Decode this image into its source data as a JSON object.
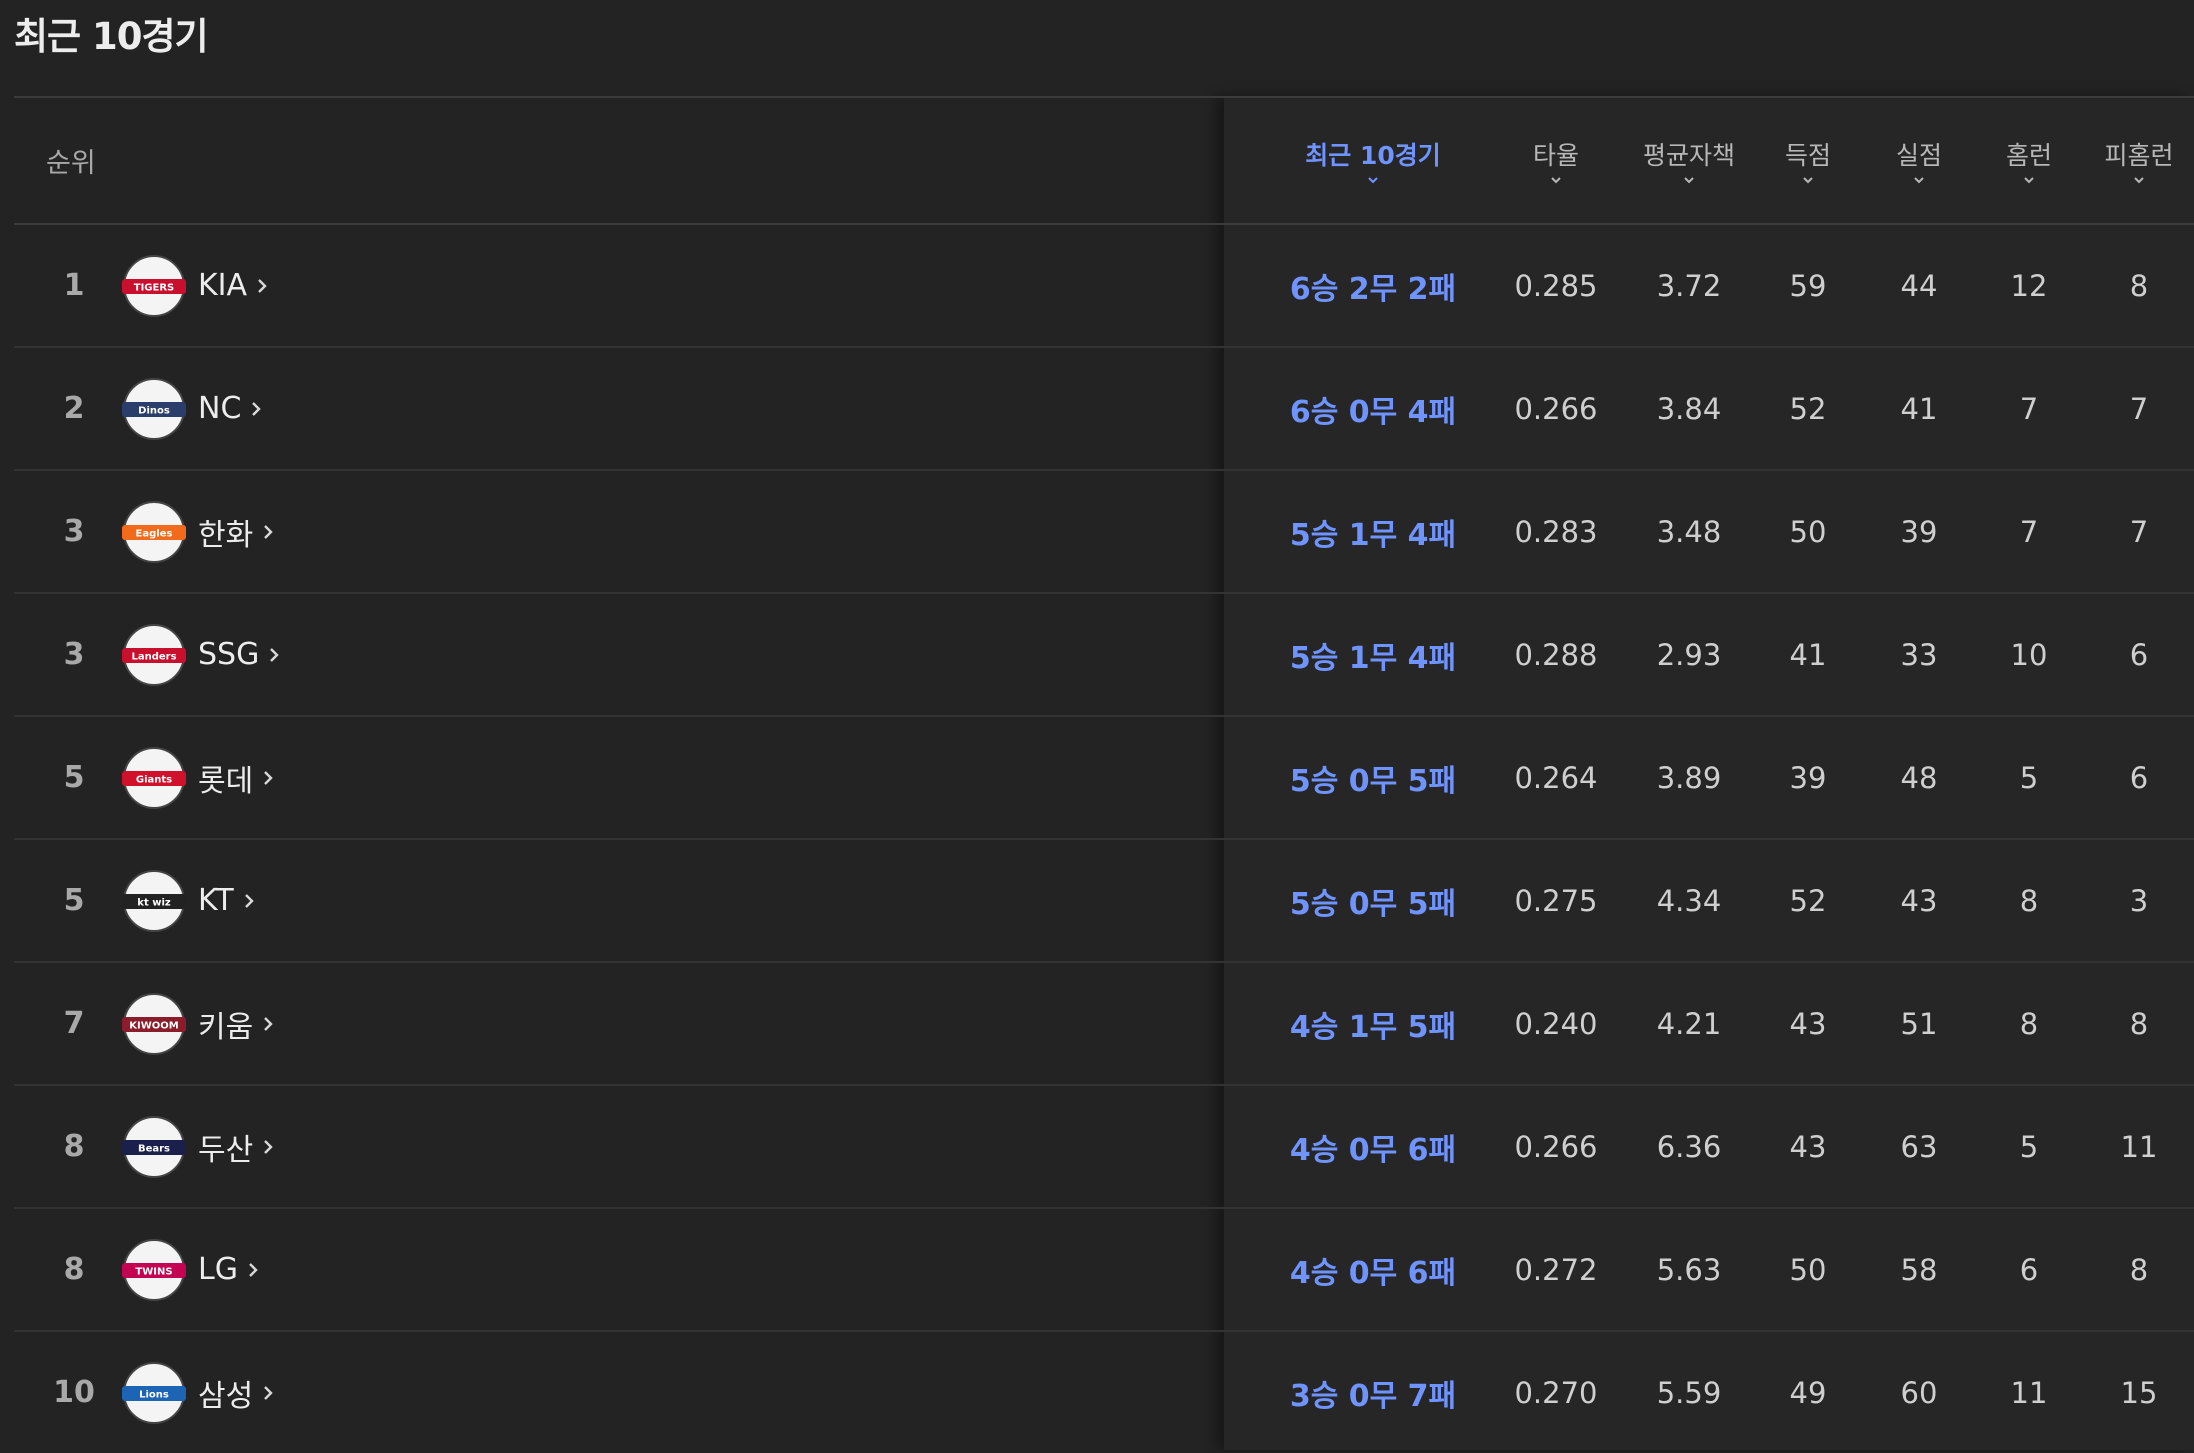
{
  "title": "최근 10경기",
  "headers": {
    "rank": "순위",
    "recent10": "최근 10경기",
    "avg": "타율",
    "era": "평균자책",
    "runs": "득점",
    "runs_allowed": "실점",
    "hr": "홈런",
    "hr_allowed": "피홈런"
  },
  "colors": {
    "accent": "#6f93ff",
    "background": "#232323"
  },
  "rows": [
    {
      "rank": "1",
      "team": "KIA",
      "logo_text": "TIGERS",
      "logo_color": "#c8102e",
      "record": "6승 2무 2패",
      "avg": "0.285",
      "era": "3.72",
      "runs": "59",
      "runs_allowed": "44",
      "hr": "12",
      "hr_allowed": "8"
    },
    {
      "rank": "2",
      "team": "NC",
      "logo_text": "Dinos",
      "logo_color": "#2b3e6b",
      "record": "6승 0무 4패",
      "avg": "0.266",
      "era": "3.84",
      "runs": "52",
      "runs_allowed": "41",
      "hr": "7",
      "hr_allowed": "7"
    },
    {
      "rank": "3",
      "team": "한화",
      "logo_text": "Eagles",
      "logo_color": "#f26b1d",
      "record": "5승 1무 4패",
      "avg": "0.283",
      "era": "3.48",
      "runs": "50",
      "runs_allowed": "39",
      "hr": "7",
      "hr_allowed": "7"
    },
    {
      "rank": "3",
      "team": "SSG",
      "logo_text": "Landers",
      "logo_color": "#c8102e",
      "record": "5승 1무 4패",
      "avg": "0.288",
      "era": "2.93",
      "runs": "41",
      "runs_allowed": "33",
      "hr": "10",
      "hr_allowed": "6"
    },
    {
      "rank": "5",
      "team": "롯데",
      "logo_text": "Giants",
      "logo_color": "#d0112b",
      "record": "5승 0무 5패",
      "avg": "0.264",
      "era": "3.89",
      "runs": "39",
      "runs_allowed": "48",
      "hr": "5",
      "hr_allowed": "6"
    },
    {
      "rank": "5",
      "team": "KT",
      "logo_text": "kt wiz",
      "logo_color": "#222222",
      "record": "5승 0무 5패",
      "avg": "0.275",
      "era": "4.34",
      "runs": "52",
      "runs_allowed": "43",
      "hr": "8",
      "hr_allowed": "3"
    },
    {
      "rank": "7",
      "team": "키움",
      "logo_text": "KIWOOM",
      "logo_color": "#8b1c2b",
      "record": "4승 1무 5패",
      "avg": "0.240",
      "era": "4.21",
      "runs": "43",
      "runs_allowed": "51",
      "hr": "8",
      "hr_allowed": "8"
    },
    {
      "rank": "8",
      "team": "두산",
      "logo_text": "Bears",
      "logo_color": "#1a1f4b",
      "record": "4승 0무 6패",
      "avg": "0.266",
      "era": "6.36",
      "runs": "43",
      "runs_allowed": "63",
      "hr": "5",
      "hr_allowed": "11"
    },
    {
      "rank": "8",
      "team": "LG",
      "logo_text": "TWINS",
      "logo_color": "#c30452",
      "record": "4승 0무 6패",
      "avg": "0.272",
      "era": "5.63",
      "runs": "50",
      "runs_allowed": "58",
      "hr": "6",
      "hr_allowed": "8"
    },
    {
      "rank": "10",
      "team": "삼성",
      "logo_text": "Lions",
      "logo_color": "#1e64b4",
      "record": "3승 0무 7패",
      "avg": "0.270",
      "era": "5.59",
      "runs": "49",
      "runs_allowed": "60",
      "hr": "11",
      "hr_allowed": "15"
    }
  ]
}
